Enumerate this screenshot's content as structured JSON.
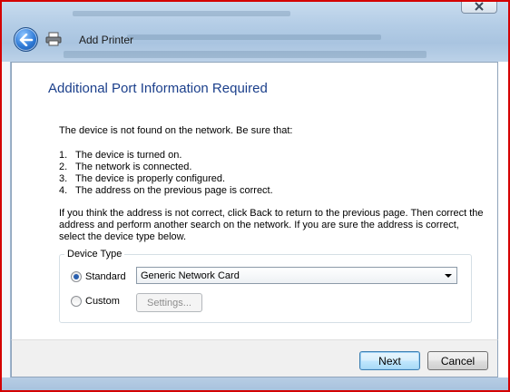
{
  "window": {
    "title": "Add Printer"
  },
  "heading": "Additional Port Information Required",
  "intro": "The device is not found on the network.  Be sure that:",
  "steps": [
    {
      "num": "1.",
      "text": "The device is turned on."
    },
    {
      "num": "2.",
      "text": "The network is connected."
    },
    {
      "num": "3.",
      "text": "The device is properly configured."
    },
    {
      "num": "4.",
      "text": "The address on the previous page is correct."
    }
  ],
  "advice": "If you think the address is not correct, click Back to return to the previous page.  Then correct the address and perform another search on the network.  If you are sure the address is correct, select the device type below.",
  "device_type": {
    "legend": "Device Type",
    "standard_label": "Standard",
    "custom_label": "Custom",
    "selected": "Standard",
    "standard_value": "Generic Network Card",
    "settings_label": "Settings..."
  },
  "footer": {
    "next_label": "Next",
    "cancel_label": "Cancel"
  },
  "icons": {
    "back": "back-arrow-icon",
    "printer": "printer-icon",
    "close": "close-icon"
  },
  "colors": {
    "heading": "#1b3f8b",
    "border_frame": "#d40000"
  }
}
